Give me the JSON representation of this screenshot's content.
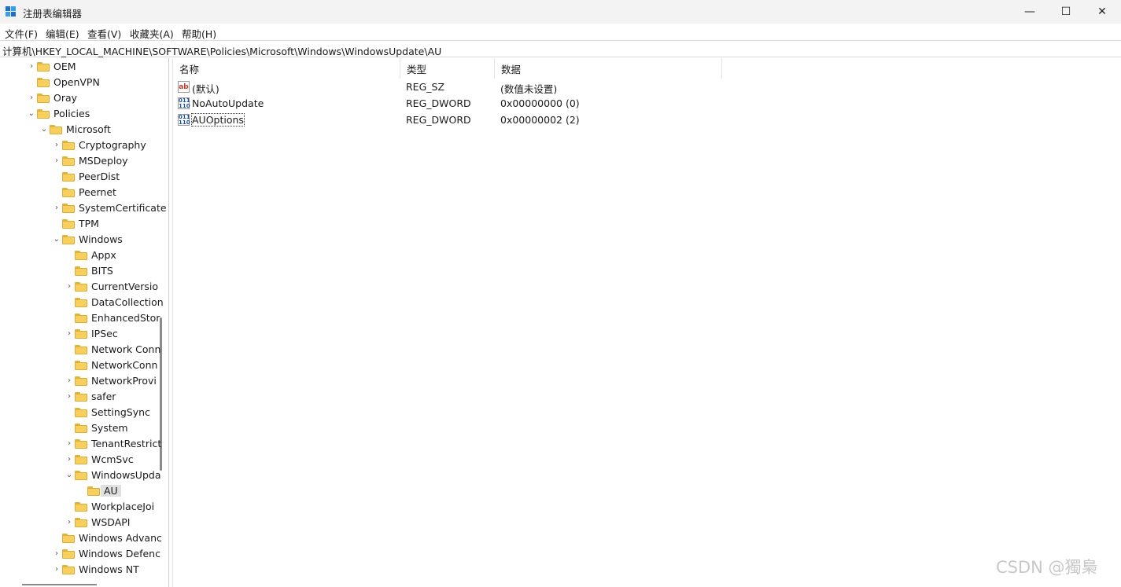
{
  "window": {
    "title": "注册表编辑器",
    "minimize": "—",
    "maximize": "☐",
    "close": "✕"
  },
  "menu": [
    "文件(F)",
    "编辑(E)",
    "查看(V)",
    "收藏夹(A)",
    "帮助(H)"
  ],
  "address": "计算机\\HKEY_LOCAL_MACHINE\\SOFTWARE\\Policies\\Microsoft\\Windows\\WindowsUpdate\\AU",
  "tree": [
    {
      "label": "OEM",
      "level": 0,
      "chevron": "collapsed"
    },
    {
      "label": "OpenVPN",
      "level": 0,
      "chevron": "none"
    },
    {
      "label": "Oray",
      "level": 0,
      "chevron": "collapsed"
    },
    {
      "label": "Policies",
      "level": 0,
      "chevron": "expanded"
    },
    {
      "label": "Microsoft",
      "level": 1,
      "chevron": "expanded"
    },
    {
      "label": "Cryptography",
      "level": 2,
      "chevron": "collapsed"
    },
    {
      "label": "MSDeploy",
      "level": 2,
      "chevron": "collapsed"
    },
    {
      "label": "PeerDist",
      "level": 2,
      "chevron": "none"
    },
    {
      "label": "Peernet",
      "level": 2,
      "chevron": "none"
    },
    {
      "label": "SystemCertificate",
      "level": 2,
      "chevron": "collapsed"
    },
    {
      "label": "TPM",
      "level": 2,
      "chevron": "none"
    },
    {
      "label": "Windows",
      "level": 2,
      "chevron": "expanded"
    },
    {
      "label": "Appx",
      "level": 3,
      "chevron": "none"
    },
    {
      "label": "BITS",
      "level": 3,
      "chevron": "none"
    },
    {
      "label": "CurrentVersio",
      "level": 3,
      "chevron": "collapsed"
    },
    {
      "label": "DataCollection",
      "level": 3,
      "chevron": "none"
    },
    {
      "label": "EnhancedStor",
      "level": 3,
      "chevron": "none"
    },
    {
      "label": "IPSec",
      "level": 3,
      "chevron": "collapsed"
    },
    {
      "label": "Network Conn",
      "level": 3,
      "chevron": "none"
    },
    {
      "label": "NetworkConn",
      "level": 3,
      "chevron": "none"
    },
    {
      "label": "NetworkProvi",
      "level": 3,
      "chevron": "collapsed"
    },
    {
      "label": "safer",
      "level": 3,
      "chevron": "collapsed"
    },
    {
      "label": "SettingSync",
      "level": 3,
      "chevron": "none"
    },
    {
      "label": "System",
      "level": 3,
      "chevron": "none"
    },
    {
      "label": "TenantRestrict",
      "level": 3,
      "chevron": "collapsed"
    },
    {
      "label": "WcmSvc",
      "level": 3,
      "chevron": "collapsed"
    },
    {
      "label": "WindowsUpda",
      "level": 3,
      "chevron": "expanded"
    },
    {
      "label": "AU",
      "level": 4,
      "chevron": "none",
      "selected": true
    },
    {
      "label": "WorkplaceJoi",
      "level": 3,
      "chevron": "none"
    },
    {
      "label": "WSDAPI",
      "level": 3,
      "chevron": "collapsed"
    },
    {
      "label": "Windows Advanc",
      "level": 2,
      "chevron": "none"
    },
    {
      "label": "Windows Defenc",
      "level": 2,
      "chevron": "collapsed"
    },
    {
      "label": "Windows NT",
      "level": 2,
      "chevron": "collapsed"
    }
  ],
  "columns": {
    "name": "名称",
    "type": "类型",
    "data": "数据"
  },
  "values": [
    {
      "icon": "ab",
      "iconName": "string-value-icon",
      "name": "(默认)",
      "type": "REG_SZ",
      "data": "(数值未设置)"
    },
    {
      "icon": "dw",
      "iconName": "dword-value-icon",
      "name": "NoAutoUpdate",
      "type": "REG_DWORD",
      "data": "0x00000000 (0)"
    },
    {
      "icon": "dw",
      "iconName": "dword-value-icon",
      "name": "AUOptions",
      "type": "REG_DWORD",
      "data": "0x00000002 (2)",
      "focused": true
    }
  ],
  "watermark": "CSDN @獨梟"
}
